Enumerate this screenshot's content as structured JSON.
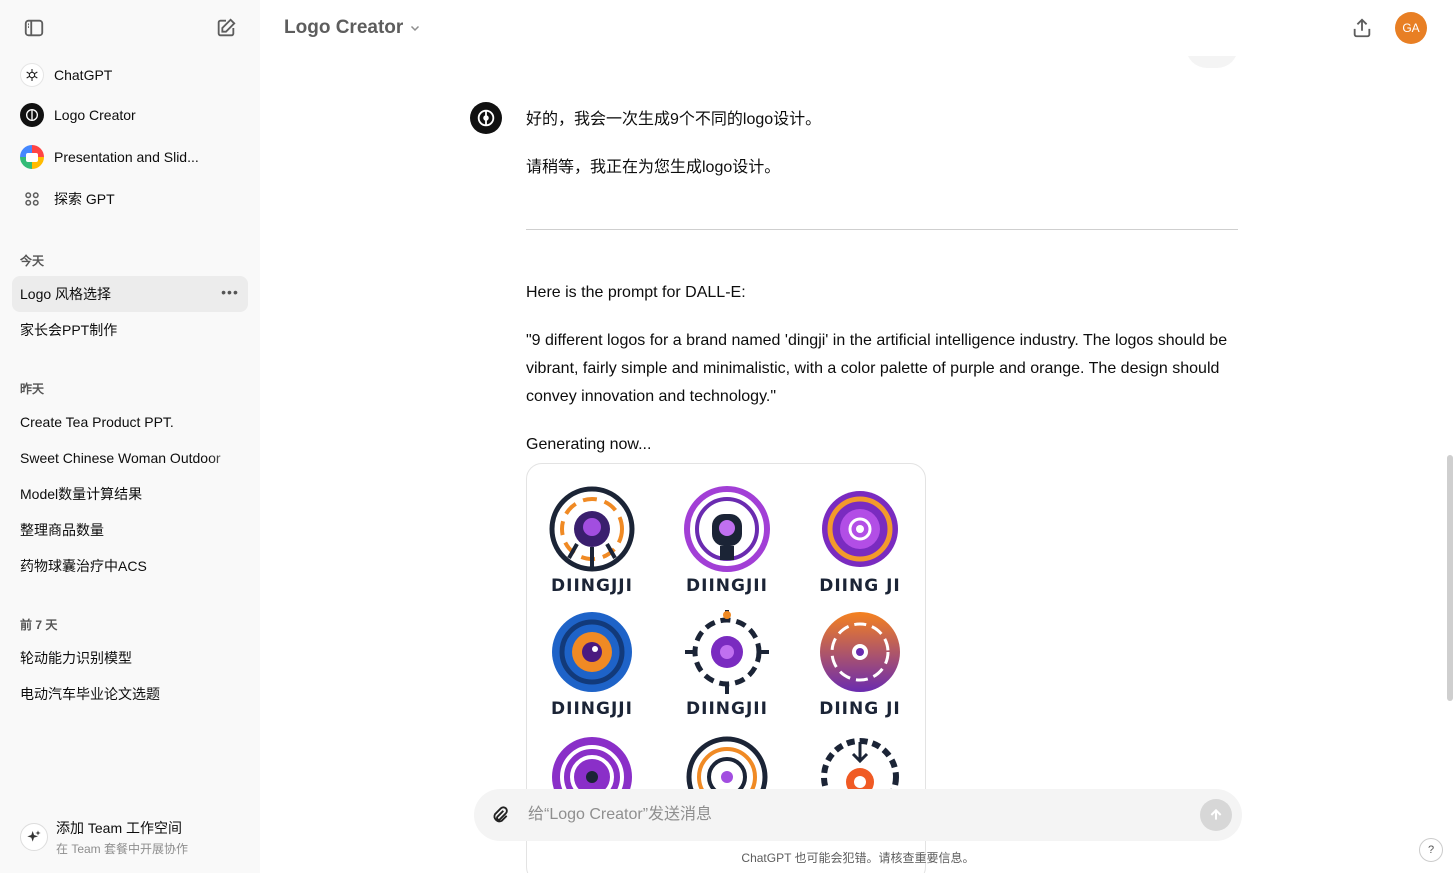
{
  "sidebar": {
    "gpts": [
      {
        "label": "ChatGPT",
        "icon": "openai-logo-icon"
      },
      {
        "label": "Logo Creator",
        "icon": "logo-creator-icon"
      },
      {
        "label": "Presentation and Slid...",
        "icon": "presentation-icon"
      },
      {
        "label": "探索 GPT",
        "icon": "grid-icon"
      }
    ],
    "sections": [
      {
        "title": "今天",
        "items": [
          "Logo 风格选择",
          "家长会PPT制作"
        ]
      },
      {
        "title": "昨天",
        "items": [
          "Create Tea Product PPT.",
          "Sweet Chinese Woman Outdoor",
          "Model数量计算结果",
          "整理商品数量",
          "药物球囊治疗中ACS"
        ]
      },
      {
        "title": "前 7 天",
        "items": [
          "轮动能力识别模型",
          "电动汽车毕业论文选题"
        ]
      }
    ],
    "team": {
      "title": "添加 Team 工作空间",
      "subtitle": "在 Team 套餐中开展协作"
    }
  },
  "header": {
    "title": "Logo Creator",
    "avatar_initials": "GA",
    "avatar_color": "#e87f24"
  },
  "chat": {
    "messages": [
      "好的，我会一次生成9个不同的logo设计。",
      "请稍等，我正在为您生成logo设计。",
      "Here is the prompt for DALL-E:",
      "\"9 different logos for a brand named 'dingji' in the artificial intelligence industry. The logos should be vibrant, fairly simple and minimalistic, with a color palette of purple and orange. The design should convey innovation and technology.\"",
      "Generating now..."
    ],
    "logos": [
      "DIINGJJI",
      "DIINGJII",
      "DIING JI",
      "DIINGJJI",
      "DIINGJII",
      "DIING JI"
    ]
  },
  "composer": {
    "placeholder": "给“Logo Creator”发送消息",
    "disclaimer": "ChatGPT 也可能会犯错。请核查重要信息。"
  },
  "help_label": "?"
}
